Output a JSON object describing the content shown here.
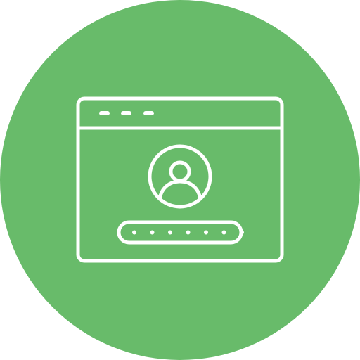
{
  "icon": {
    "name": "browser-login-icon",
    "colors": {
      "background": "#68BB6A",
      "stroke": "#FFFFFF"
    },
    "password_mask_count": 7
  }
}
